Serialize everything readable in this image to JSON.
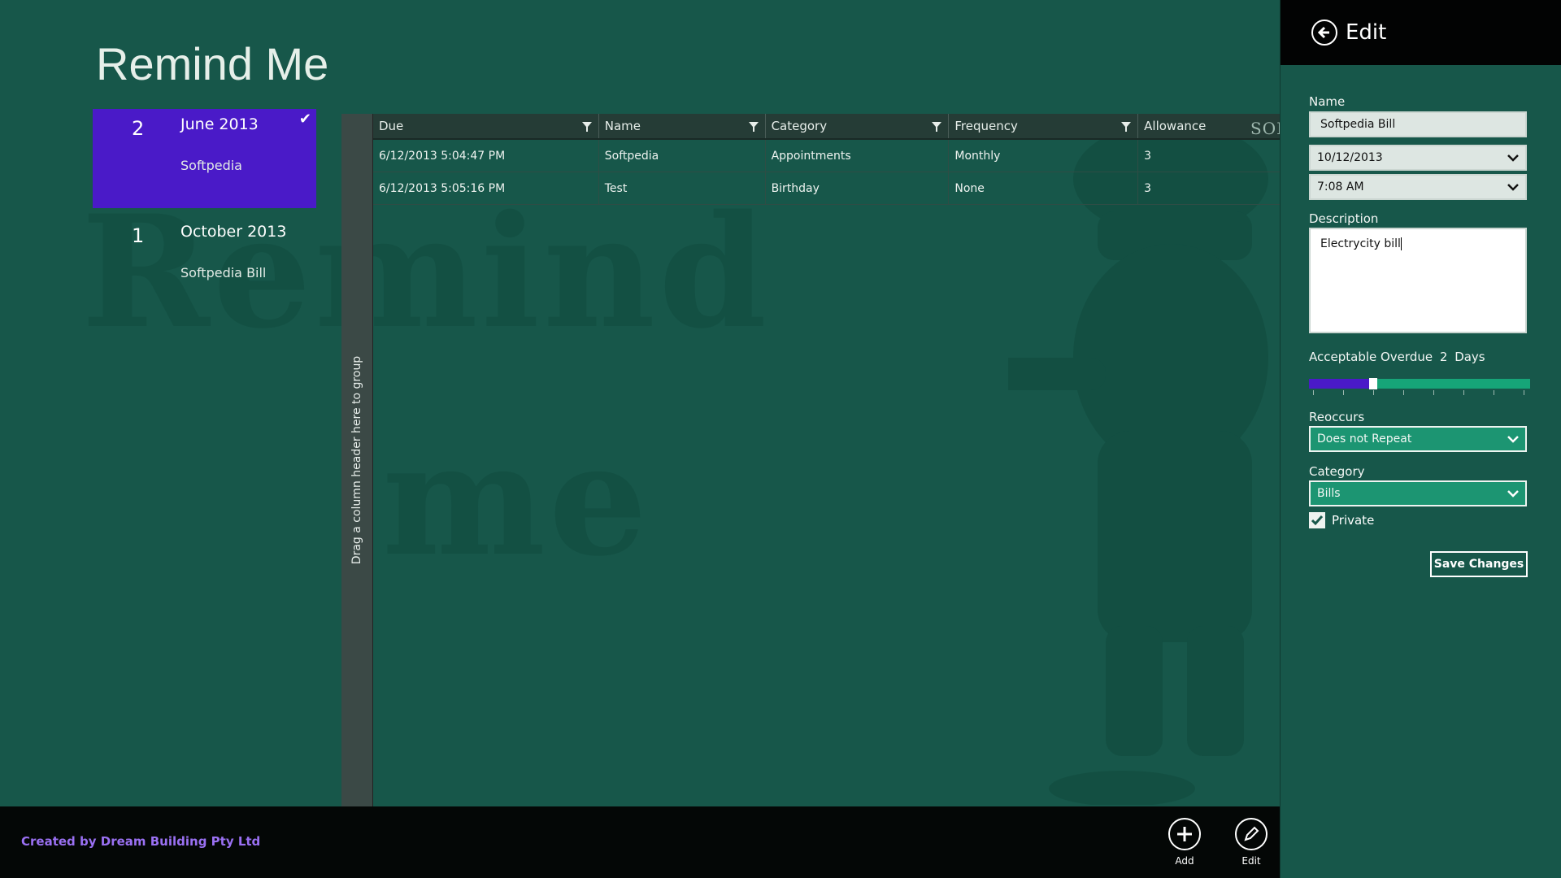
{
  "app": {
    "title": "Remind Me",
    "credit": "Created by Dream Building Pty Ltd",
    "watermark_line1": "Remind",
    "watermark_line2": "me"
  },
  "groups": [
    {
      "count": "2",
      "month": "June 2013",
      "items": [
        "Softpedia"
      ],
      "selected": true
    },
    {
      "count": "1",
      "month": "October 2013",
      "items": [
        "Softpedia Bill"
      ],
      "selected": false
    }
  ],
  "grid": {
    "group_hint": "Drag a column header here to group",
    "columns": [
      "Due",
      "Name",
      "Category",
      "Frequency",
      "Allowance"
    ],
    "rows": [
      [
        "6/12/2013 5:04:47 PM",
        "Softpedia",
        "Appointments",
        "Monthly",
        "3"
      ],
      [
        "6/12/2013 5:05:16 PM",
        "Test",
        "Birthday",
        "None",
        "3"
      ]
    ]
  },
  "softpedia_mark": "SOFTPEDIA",
  "appbar": {
    "add_label": "Add",
    "edit_label": "Edit"
  },
  "edit_panel": {
    "title": "Edit",
    "name_label": "Name",
    "name_value": "Softpedia Bill",
    "date_value": "10/12/2013",
    "time_value": "7:08 AM",
    "description_label": "Description",
    "description_value": "Electrycity bill",
    "overdue_label": "Acceptable Overdue",
    "overdue_value": "2",
    "overdue_unit": "Days",
    "overdue_fraction": 0.29,
    "reoccurs_label": "Reoccurs",
    "reoccurs_value": "Does not Repeat",
    "category_label": "Category",
    "category_value": "Bills",
    "private_label": "Private",
    "private_checked": true,
    "save_label": "Save Changes"
  },
  "colors": {
    "background": "#17574a",
    "accent": "#4a1ac8",
    "slider_track": "#16a578",
    "credit": "#9a70f2"
  }
}
